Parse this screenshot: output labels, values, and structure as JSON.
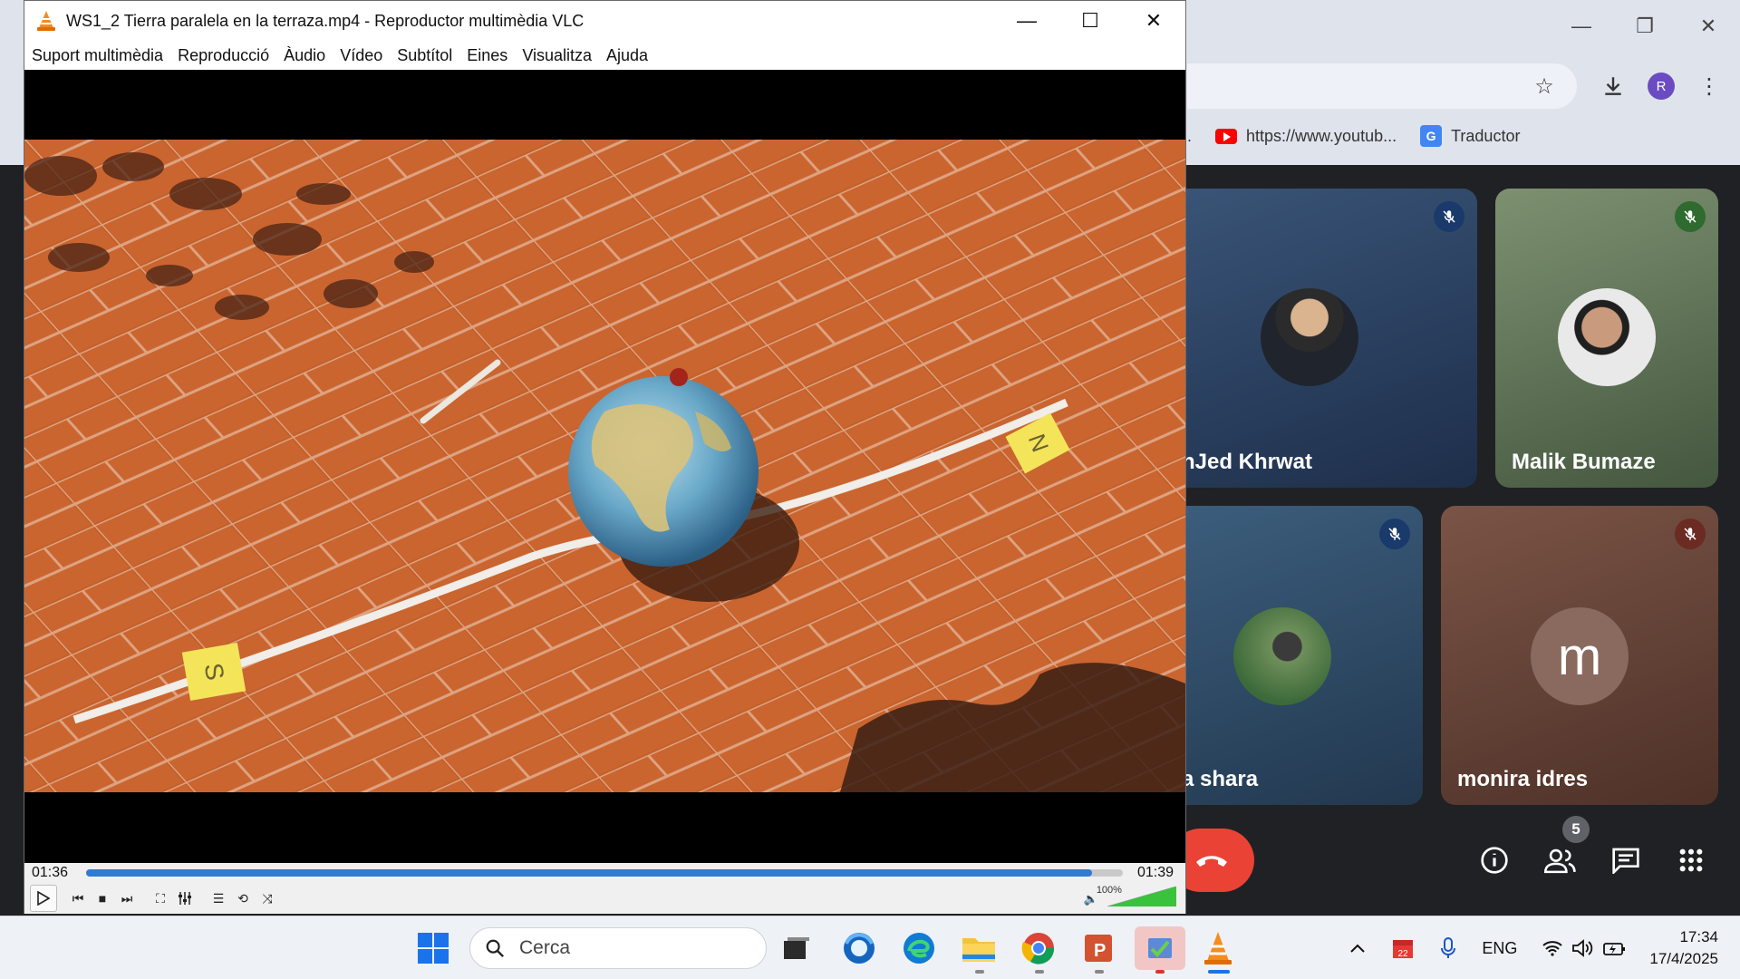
{
  "vlc": {
    "title": "WS1_2 Tierra paralela en la terraza.mp4 - Reproductor multimèdia VLC",
    "menu": [
      "Suport multimèdia",
      "Reproducció",
      "Àudio",
      "Vídeo",
      "Subtítol",
      "Eines",
      "Visualitza",
      "Ajuda"
    ],
    "time_elapsed": "01:36",
    "time_total": "01:39",
    "progress_fraction": 0.97,
    "volume": "100%",
    "volume_fraction": 1.0,
    "video_labels": {
      "south_note": "S",
      "north_note": "N"
    },
    "window_controls": {
      "minimize": "minimize-icon",
      "maximize": "maximize-icon",
      "close": "close-icon"
    }
  },
  "chrome": {
    "bookmarks": [
      "...",
      "https://www.youtub...",
      "Traductor"
    ],
    "profile_initial": "R",
    "colors": {
      "frame": "#dfe3ec",
      "profile": "#6b4bc1"
    }
  },
  "meet": {
    "participants": [
      {
        "name": "nJed Khrwat",
        "muted": true
      },
      {
        "name": "Malik Bumaze",
        "muted": true
      },
      {
        "name": "a shara",
        "muted": true
      },
      {
        "name": "monira idres",
        "muted": true,
        "initial": "m"
      }
    ],
    "people_count": "5",
    "colors": {
      "hangup": "#ea4335",
      "background": "#202124"
    }
  },
  "taskbar": {
    "search_placeholder": "Cerca",
    "calendar_day": "22",
    "language": "ENG",
    "time": "17:34",
    "date": "17/4/2025"
  }
}
